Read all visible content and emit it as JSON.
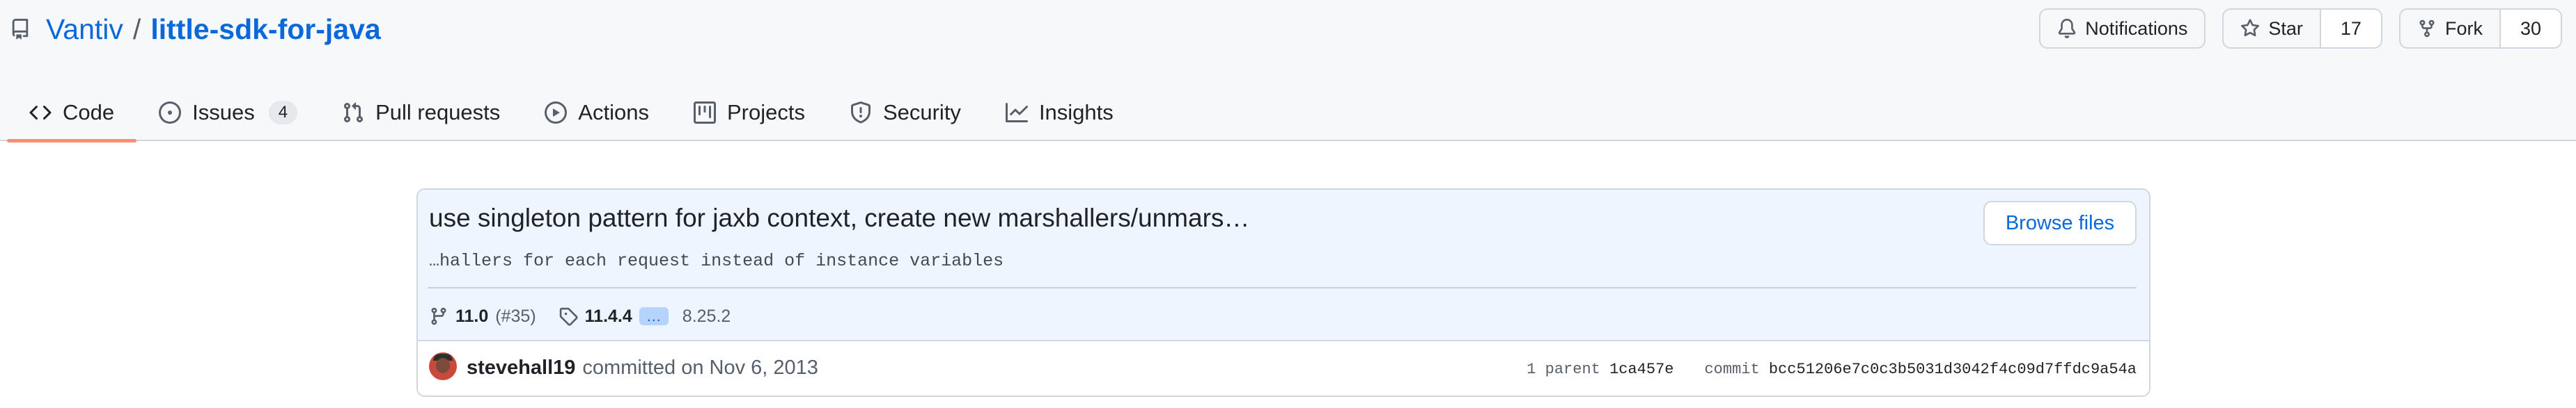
{
  "repo": {
    "owner": "Vantiv",
    "separator": "/",
    "name": "little-sdk-for-java"
  },
  "actions": {
    "notifications_label": "Notifications",
    "star_label": "Star",
    "star_count": "17",
    "fork_label": "Fork",
    "fork_count": "30"
  },
  "tabs": [
    {
      "label": "Code",
      "icon": "code-icon"
    },
    {
      "label": "Issues",
      "icon": "issue-icon",
      "count": "4"
    },
    {
      "label": "Pull requests",
      "icon": "pull-request-icon"
    },
    {
      "label": "Actions",
      "icon": "play-icon"
    },
    {
      "label": "Projects",
      "icon": "table-icon"
    },
    {
      "label": "Security",
      "icon": "shield-icon"
    },
    {
      "label": "Insights",
      "icon": "graph-icon"
    }
  ],
  "commit": {
    "title": "use singleton pattern for jaxb context, create new marshallers/unmars…",
    "description": "…hallers for each request instead of instance variables",
    "browse_label": "Browse files",
    "branch": "11.0",
    "pr": "(#35)",
    "tag": "11.4.4",
    "tag_more": "…",
    "tag_alt": "8.25.2",
    "author": "stevehall19",
    "committed_text": "committed on Nov 6, 2013",
    "parent_label": "1 parent",
    "parent_sha": "1ca457e",
    "commit_label": "commit",
    "commit_sha": "bcc51206e7c0c3b5031d3042f4c09d7ffdc9a54a"
  },
  "colors": {
    "accent": "#0969da",
    "tab_underline": "#fd8c73",
    "commit_header_bg": "#eef5fe"
  }
}
